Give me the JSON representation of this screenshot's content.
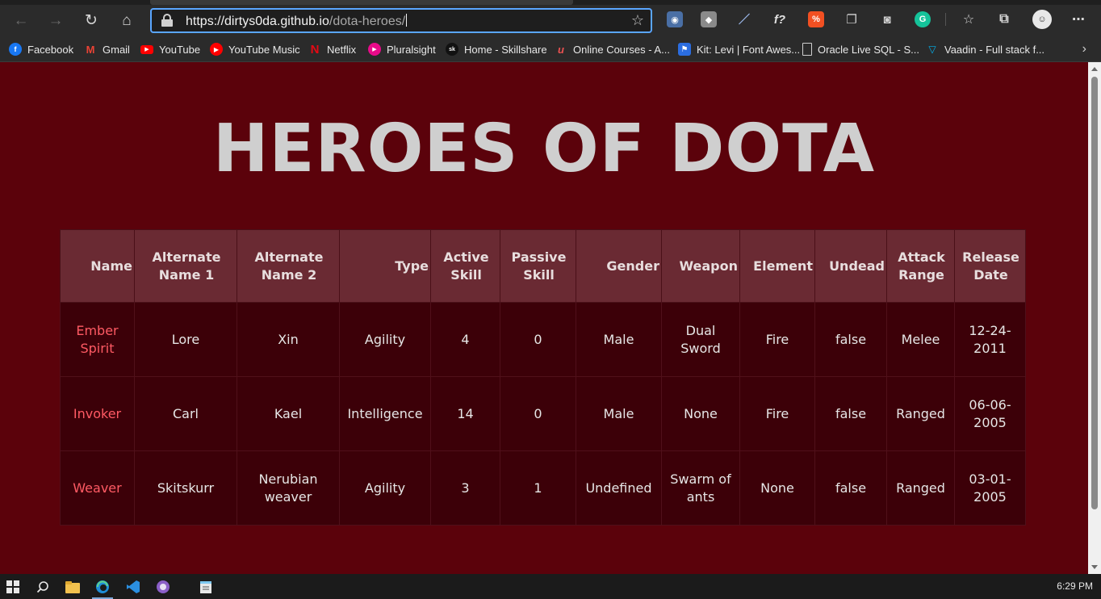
{
  "browser": {
    "url_host": "https://dirtys0da.github.io",
    "url_path": "/dota-heroes/",
    "bookmarks": [
      {
        "label": "Facebook",
        "icon": "facebook-icon",
        "color": "#1877f2",
        "glyph": "f"
      },
      {
        "label": "Gmail",
        "icon": "gmail-icon",
        "color": "#ea4335",
        "glyph": "M"
      },
      {
        "label": "YouTube",
        "icon": "youtube-icon",
        "color": "#ff0000",
        "glyph": "▶"
      },
      {
        "label": "YouTube Music",
        "icon": "youtube-music-icon",
        "color": "#ff0000",
        "glyph": "◉"
      },
      {
        "label": "Netflix",
        "icon": "netflix-icon",
        "color": "#e50914",
        "glyph": "N"
      },
      {
        "label": "Pluralsight",
        "icon": "pluralsight-icon",
        "color": "#e80a89",
        "glyph": "▶"
      },
      {
        "label": "Home - Skillshare",
        "icon": "skillshare-icon",
        "color": "#2b2b2b",
        "glyph": "sk"
      },
      {
        "label": "Online Courses - A...",
        "icon": "udemy-icon",
        "color": "#2b2b2b",
        "glyph": "u"
      },
      {
        "label": "Kit: Levi | Font Awes...",
        "icon": "font-awesome-icon",
        "color": "#2b6de0",
        "glyph": "⚑"
      },
      {
        "label": "Oracle Live SQL - S...",
        "icon": "document-icon",
        "color": "#2b2b2b",
        "glyph": "▯"
      },
      {
        "label": "Vaadin - Full stack f...",
        "icon": "vaadin-icon",
        "color": "#2b2b2b",
        "glyph": "▽"
      }
    ]
  },
  "page": {
    "title": "HEROES OF DOTA"
  },
  "table": {
    "headers": [
      "Name",
      "Alternate Name 1",
      "Alternate Name 2",
      "Type",
      "Active Skill",
      "Passive Skill",
      "Gender",
      "Weapon",
      "Element",
      "Undead",
      "Attack Range",
      "Release Date"
    ],
    "rows": [
      [
        "Ember Spirit",
        "Lore",
        "Xin",
        "Agility",
        "4",
        "0",
        "Male",
        "Dual Sword",
        "Fire",
        "false",
        "Melee",
        "12-24-2011"
      ],
      [
        "Invoker",
        "Carl",
        "Kael",
        "Intelligence",
        "14",
        "0",
        "Male",
        "None",
        "Fire",
        "false",
        "Ranged",
        "06-06-2005"
      ],
      [
        "Weaver",
        "Skitskurr",
        "Nerubian weaver",
        "Agility",
        "3",
        "1",
        "Undefined",
        "Swarm of ants",
        "None",
        "false",
        "Ranged",
        "03-01-2005"
      ]
    ]
  },
  "taskbar": {
    "time": "6:29 PM"
  },
  "colors": {
    "page_background": "#5b020b",
    "header_cell": "#6a2a33",
    "body_cell": "#3c0008",
    "hero_name": "#ff5a64"
  }
}
